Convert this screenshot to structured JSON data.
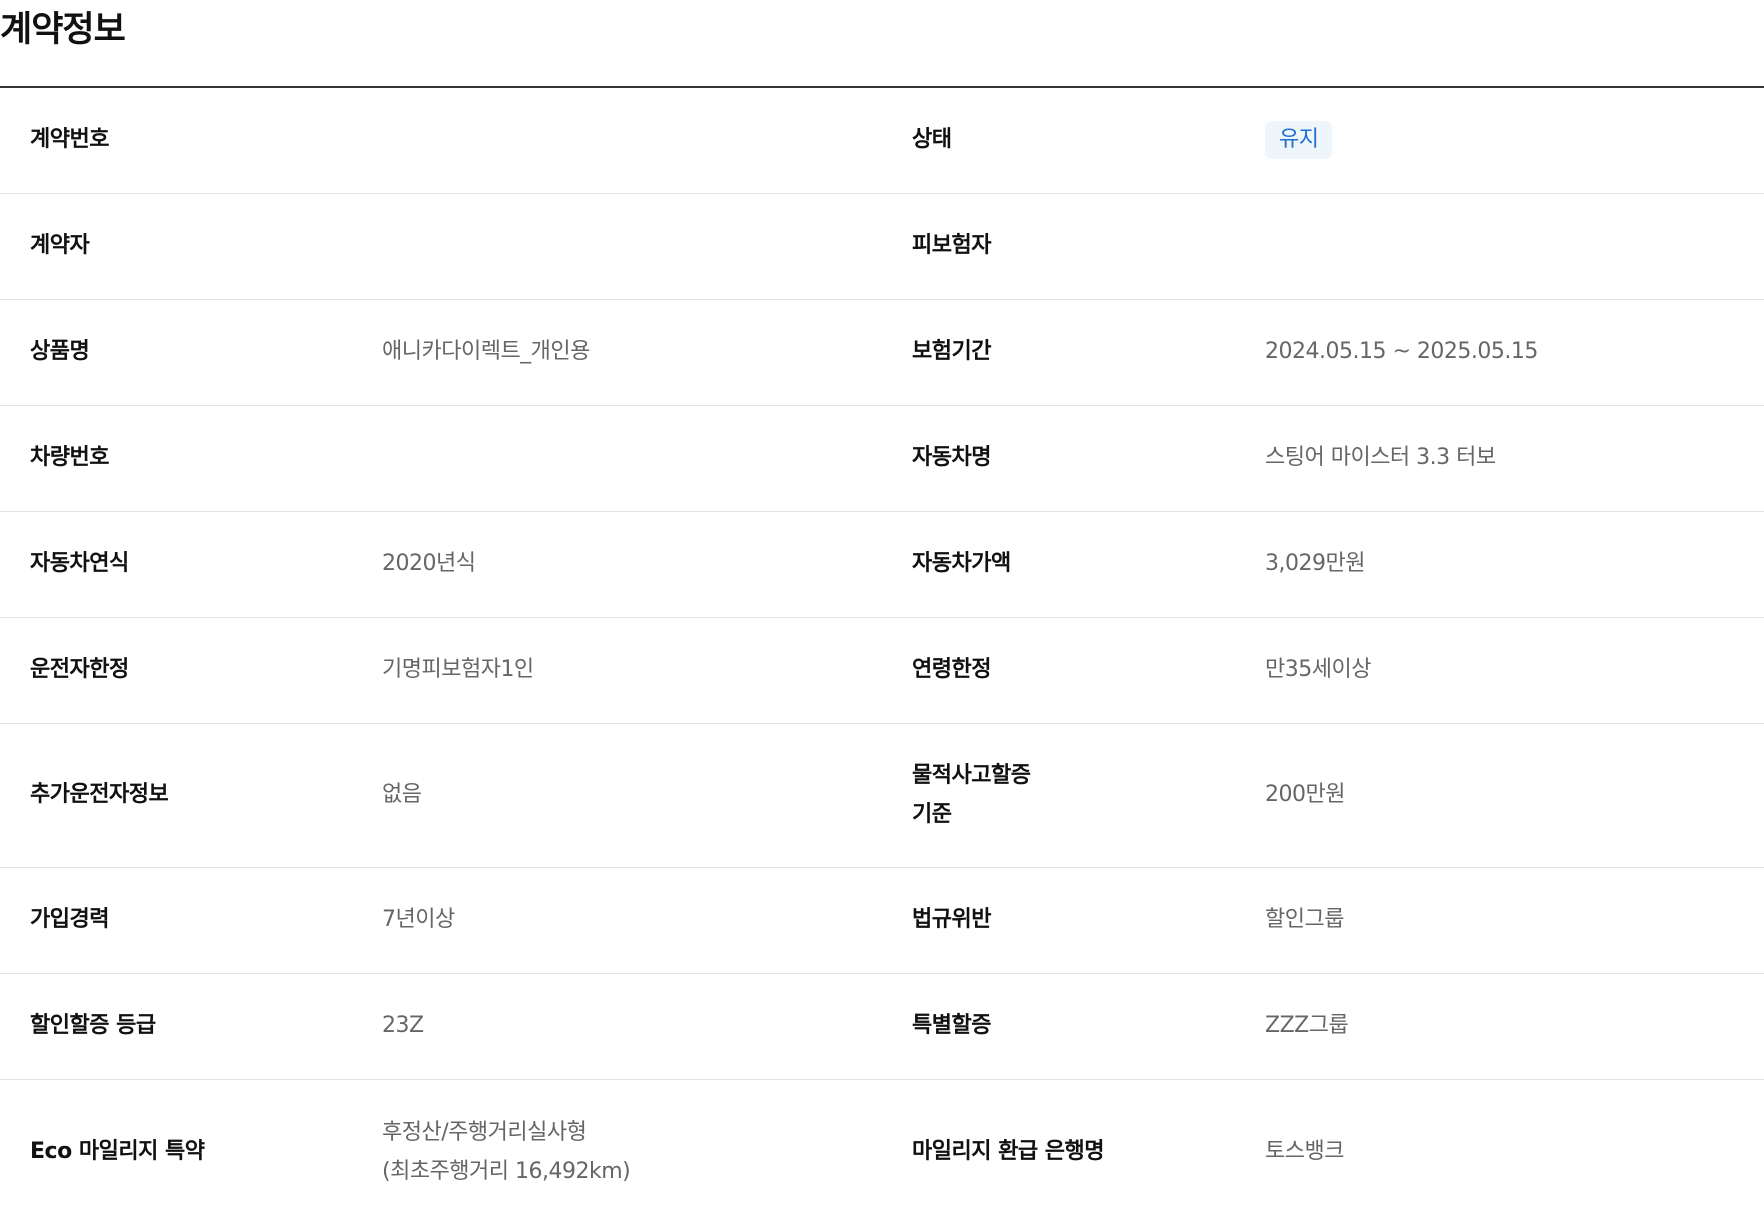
{
  "page": {
    "title": "계약정보"
  },
  "rows": [
    {
      "left_label": "계약번호",
      "left_value": "",
      "right_label": "상태",
      "right_value": "유지"
    },
    {
      "left_label": "계약자",
      "left_value": "",
      "right_label": "피보험자",
      "right_value": ""
    },
    {
      "left_label": "상품명",
      "left_value": "애니카다이렉트_개인용",
      "right_label": "보험기간",
      "right_value": "2024.05.15 ~ 2025.05.15"
    },
    {
      "left_label": "차량번호",
      "left_value": "",
      "right_label": "자동차명",
      "right_value": "스팅어 마이스터 3.3 터보"
    },
    {
      "left_label": "자동차연식",
      "left_value": "2020년식",
      "right_label": "자동차가액",
      "right_value": "3,029만원"
    },
    {
      "left_label": "운전자한정",
      "left_value": "기명피보험자1인",
      "right_label": "연령한정",
      "right_value": "만35세이상"
    },
    {
      "left_label": "추가운전자정보",
      "left_value": "없음",
      "right_label_line1": "물적사고할증",
      "right_label_line2": "기준",
      "right_value": "200만원"
    },
    {
      "left_label": "가입경력",
      "left_value": "7년이상",
      "right_label": "법규위반",
      "right_value": "할인그룹"
    },
    {
      "left_label": "할인할증 등급",
      "left_value": "23Z",
      "right_label": "특별할증",
      "right_value": "ZZZ그룹"
    },
    {
      "left_label": "Eco 마일리지 특약",
      "left_value_line1": "후정산/주행거리실사형",
      "left_value_line2": "(최초주행거리 16,492km)",
      "right_label": "마일리지 환급 은행명",
      "right_value": "토스뱅크"
    }
  ],
  "colors": {
    "status_badge_bg": "#eef5fb",
    "status_badge_text": "#1f6fd0",
    "header_rule": "#333333",
    "row_divider": "#e5e5e5"
  }
}
